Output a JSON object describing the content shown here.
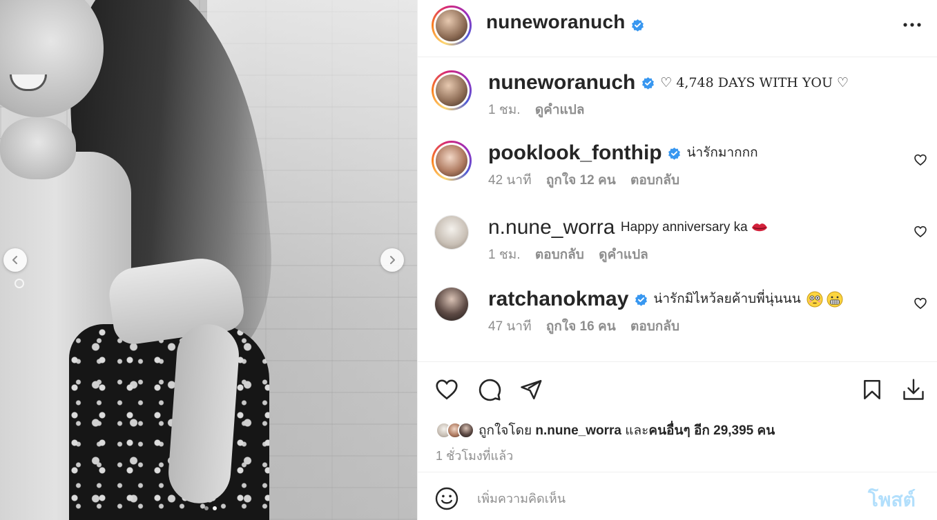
{
  "post_author": {
    "username": "nuneworanuch",
    "verified": true
  },
  "caption": {
    "username": "nuneworanuch",
    "text": "♡ 4,748 DAYS WITH YOU ♡",
    "time": "1 ชม.",
    "translate": "ดูคำแปล"
  },
  "comments": [
    {
      "username": "pooklook_fonthip",
      "verified": true,
      "text": "น่ารักมากกก",
      "time": "42 นาที",
      "likes": "ถูกใจ 12 คน",
      "reply": "ตอบกลับ"
    },
    {
      "username": "n.nune_worra",
      "verified": false,
      "text": "Happy anniversary ka",
      "emoji": "lips-emoji",
      "time": "1 ชม.",
      "reply": "ตอบกลับ",
      "translate": "ดูคำแปล"
    },
    {
      "username": "ratchanokmay",
      "verified": true,
      "text": "น่ารักมิไหว้ลยค้าบพี่นุ่นนน",
      "emoji": [
        "flushed-face-emoji",
        "grimacing-face-emoji"
      ],
      "time": "47 นาที",
      "likes": "ถูกใจ 16 คน",
      "reply": "ตอบกลับ"
    }
  ],
  "likes_summary": {
    "prefix": "ถูกใจโดย",
    "user": "n.nune_worra",
    "joiner": "และ",
    "others": "คนอื่นๆ อีก 29,395 คน"
  },
  "posted_time": "1 ชั่วโมงที่แล้ว",
  "composer": {
    "placeholder": "เพิ่มความคิดเห็น",
    "post_label": "โพสต์"
  },
  "icons": {
    "more": "more-options-icon",
    "like": "heart-icon",
    "comment": "comment-bubble-icon",
    "share": "paper-plane-icon",
    "save": "bookmark-icon",
    "download": "download-icon",
    "emoji": "smiley-icon",
    "prev": "chevron-left-icon",
    "next": "chevron-right-icon"
  },
  "colors": {
    "verified": "#3897f0",
    "post_button_disabled": "#b2dffc",
    "secondary_text": "#8e8e8e"
  }
}
